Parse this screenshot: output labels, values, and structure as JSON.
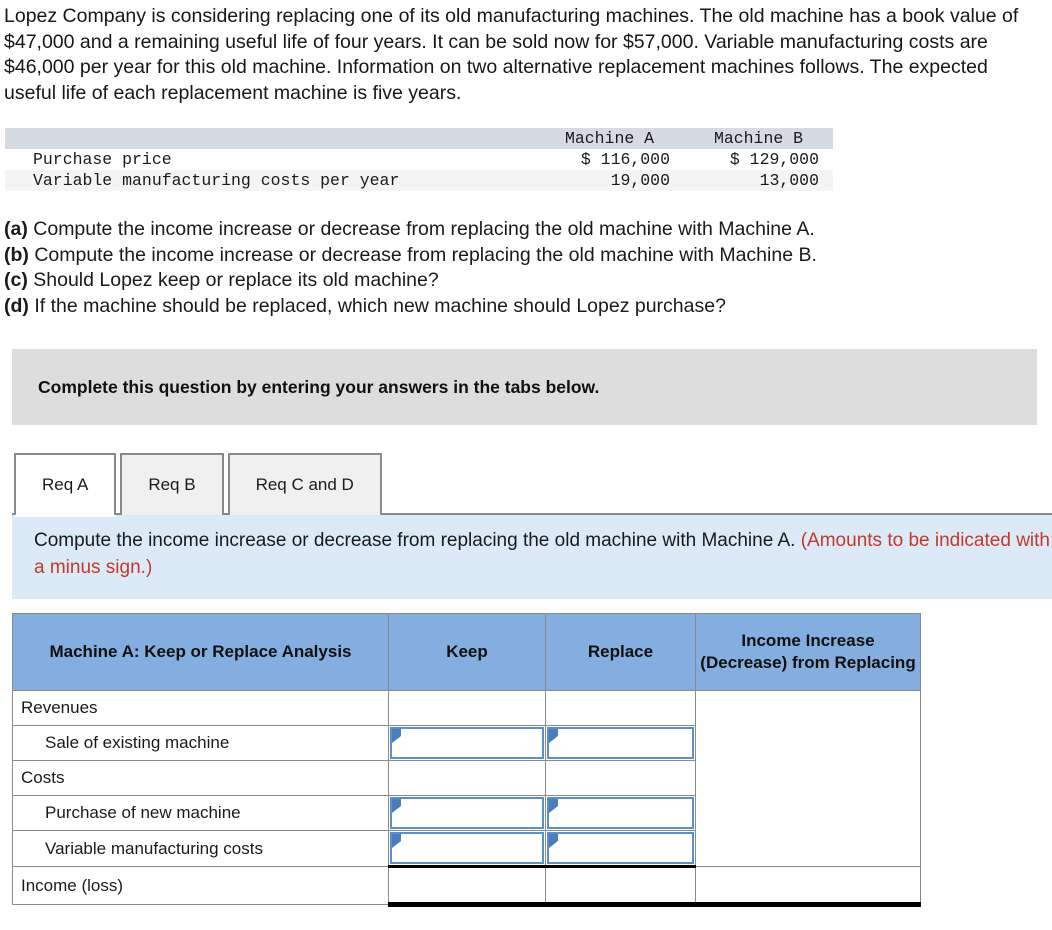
{
  "problem": {
    "text": "Lopez Company is considering replacing one of its old manufacturing machines. The old machine has a book value of $47,000 and a remaining useful life of four years. It can be sold now for $57,000. Variable manufacturing costs are $46,000 per year for this old machine. Information on two alternative replacement machines follows. The expected useful life of each replacement machine is five years."
  },
  "given_table": {
    "headers": [
      "",
      "Machine A",
      "Machine B"
    ],
    "rows": [
      {
        "label": "Purchase price",
        "machine_a": "$ 116,000",
        "machine_b": "$ 129,000"
      },
      {
        "label": "Variable manufacturing costs per year",
        "machine_a": "19,000",
        "machine_b": "13,000"
      }
    ]
  },
  "requirements": [
    {
      "tag": "(a)",
      "text": " Compute the income increase or decrease from replacing the old machine with Machine A."
    },
    {
      "tag": "(b)",
      "text": " Compute the income increase or decrease from replacing the old machine with Machine B."
    },
    {
      "tag": "(c)",
      "text": " Should Lopez keep or replace its old machine?"
    },
    {
      "tag": "(d)",
      "text": " If the machine should be replaced, which new machine should Lopez purchase?"
    }
  ],
  "banner": {
    "text": "Complete this question by entering your answers in the tabs below."
  },
  "tabs": [
    {
      "label": "Req A",
      "active": true
    },
    {
      "label": "Req B",
      "active": false
    },
    {
      "label": "Req C and D",
      "active": false
    }
  ],
  "instruction": {
    "main": "Compute the income increase or decrease from replacing the old machine with Machine A. ",
    "note": "(Amounts to be indicated with a minus sign.)"
  },
  "answer_table": {
    "headers": {
      "analysis": "Machine A: Keep or Replace Analysis",
      "keep": "Keep",
      "replace": "Replace",
      "income": "Income Increase (Decrease) from Replacing"
    },
    "rows": [
      {
        "label": "Revenues",
        "indent": false,
        "keep_input": false,
        "replace_input": false
      },
      {
        "label": "Sale of existing machine",
        "indent": true,
        "keep_input": true,
        "replace_input": true
      },
      {
        "label": "Costs",
        "indent": false,
        "keep_input": false,
        "replace_input": false
      },
      {
        "label": "Purchase of new machine",
        "indent": true,
        "keep_input": true,
        "replace_input": true
      },
      {
        "label": "Variable manufacturing costs",
        "indent": true,
        "keep_input": true,
        "replace_input": true
      },
      {
        "label": "Income (loss)",
        "indent": false,
        "keep_input": false,
        "replace_input": false
      }
    ]
  },
  "colors": {
    "header_blue": "#85aee0",
    "panel_blue": "#dceaf7",
    "banner_gray": "#dddddd",
    "given_header_gray": "#d6dae3",
    "input_border_blue": "#5b8fc9",
    "note_red": "#c0392b"
  }
}
